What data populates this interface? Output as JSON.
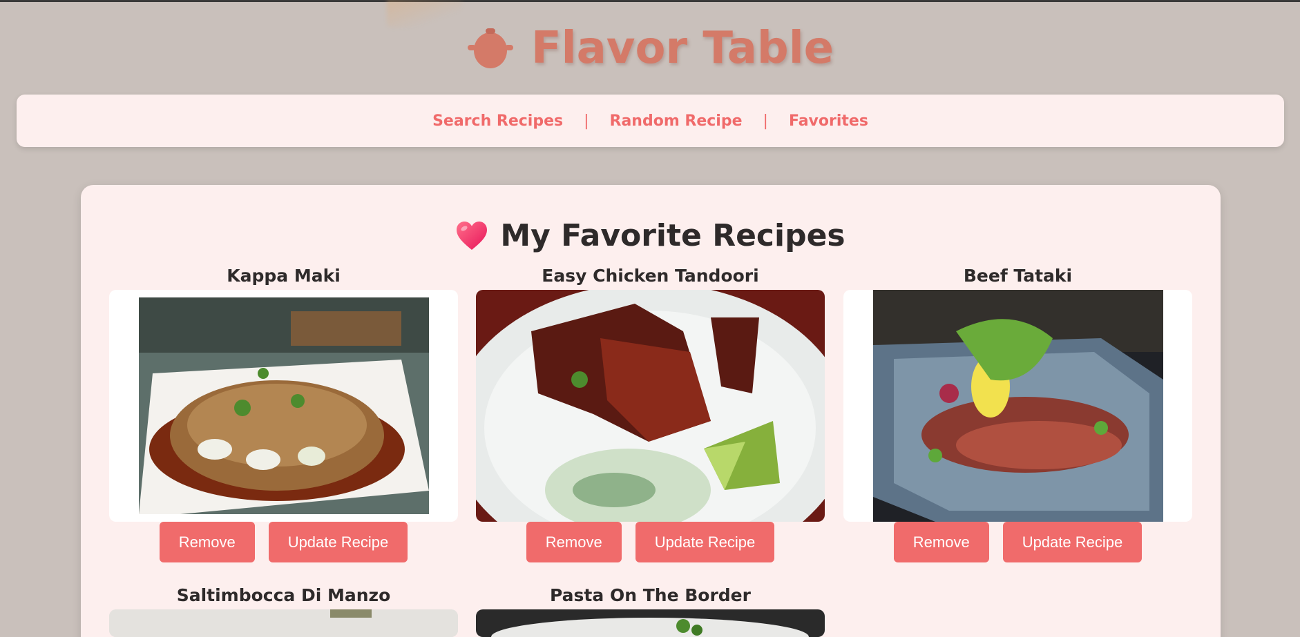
{
  "app": {
    "title": "Flavor Table",
    "brand_color": "#d47a68",
    "accent_color": "#f06b6b",
    "logo_icon": "cooking-pot-icon"
  },
  "nav": {
    "items": [
      {
        "label": "Search Recipes"
      },
      {
        "label": "Random Recipe"
      },
      {
        "label": "Favorites"
      }
    ],
    "separator": "|"
  },
  "favorites": {
    "heading": "My Favorite Recipes",
    "heading_icon": "heart-icon",
    "recipes": [
      {
        "title": "Kappa Maki",
        "image": "food-photo-icon",
        "remove_label": "Remove",
        "update_label": "Update Recipe"
      },
      {
        "title": "Easy Chicken Tandoori",
        "image": "food-photo-icon",
        "remove_label": "Remove",
        "update_label": "Update Recipe"
      },
      {
        "title": "Beef Tataki",
        "image": "food-photo-icon",
        "remove_label": "Remove",
        "update_label": "Update Recipe"
      },
      {
        "title": "Saltimbocca Di Manzo",
        "image": "food-photo-icon"
      },
      {
        "title": "Pasta On The Border",
        "image": "food-photo-icon"
      }
    ]
  }
}
